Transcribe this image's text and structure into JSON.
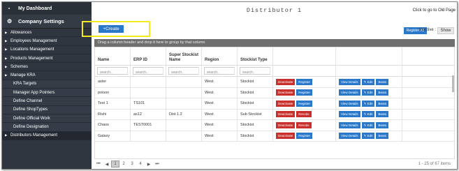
{
  "sidebar": {
    "dashboard": "My Dashboard",
    "settings": "Company Settings",
    "items": [
      {
        "label": "Allowances",
        "sub": false,
        "arrow": true
      },
      {
        "label": "Employees Management",
        "sub": false,
        "arrow": true
      },
      {
        "label": "Locations Management",
        "sub": false,
        "arrow": true
      },
      {
        "label": "Products Management",
        "sub": false,
        "arrow": true
      },
      {
        "label": "Schemes",
        "sub": false,
        "arrow": true
      },
      {
        "label": "Manage KRA",
        "sub": false,
        "arrow": true
      },
      {
        "label": "KRA Targets",
        "sub": true,
        "arrow": false
      },
      {
        "label": "Manager App Pointers",
        "sub": true,
        "arrow": false
      },
      {
        "label": "Define Channel",
        "sub": true,
        "arrow": false
      },
      {
        "label": "Define ShopTypes",
        "sub": true,
        "arrow": false
      },
      {
        "label": "Define Official Work",
        "sub": true,
        "arrow": false
      },
      {
        "label": "Define Designation",
        "sub": true,
        "arrow": false
      },
      {
        "label": "Distributors Management",
        "sub": false,
        "arrow": true
      }
    ]
  },
  "header": {
    "title": "Distributor 1",
    "old_link": "Click to go to Old Page",
    "create": "+Create",
    "register_all": "Register All",
    "inactive": "Inactive :",
    "show": "Show"
  },
  "grid": {
    "group_hint": "Drag a column header and drop it here to group by that column",
    "columns": [
      "Name",
      "ERP ID",
      "Super Stockist Name",
      "Region",
      "Stockist Type",
      "",
      ""
    ],
    "filter_placeholder": "search..",
    "rows": [
      {
        "name": "aster",
        "erp": "",
        "super": "",
        "region": "West",
        "type": "Stockist",
        "a1": "Deactivate",
        "a2": "Register",
        "a2c": "blue"
      },
      {
        "name": "poison",
        "erp": "",
        "super": "",
        "region": "West",
        "type": "Stockist",
        "a1": "Deactivate",
        "a2": "Register",
        "a2c": "blue"
      },
      {
        "name": "Test 1",
        "erp": "TS101",
        "super": "",
        "region": "West",
        "type": "Stockist",
        "a1": "Deactivate",
        "a2": "Register",
        "a2c": "blue"
      },
      {
        "name": "Rishi",
        "erp": "as12",
        "super": "Dist 1.2",
        "region": "West",
        "type": "Sub Stockist",
        "a1": "Deactivate",
        "a2": "Revoke",
        "a2c": "red"
      },
      {
        "name": "Chaos",
        "erp": "TEST0001",
        "super": "",
        "region": "West",
        "type": "Stockist",
        "a1": "Deactivate",
        "a2": "Revoke",
        "a2c": "red"
      },
      {
        "name": "Galaxy",
        "erp": "",
        "super": "",
        "region": "West",
        "type": "Stockist",
        "a1": "Deactivate",
        "a2": "Register",
        "a2c": "blue"
      }
    ],
    "actions": {
      "view": "View Details",
      "edit": "Edit",
      "beats": "Beats"
    }
  },
  "pager": {
    "pages": [
      "1",
      "2",
      "3",
      "4"
    ],
    "current": "1",
    "count": "1 - 25 of 67 items"
  }
}
